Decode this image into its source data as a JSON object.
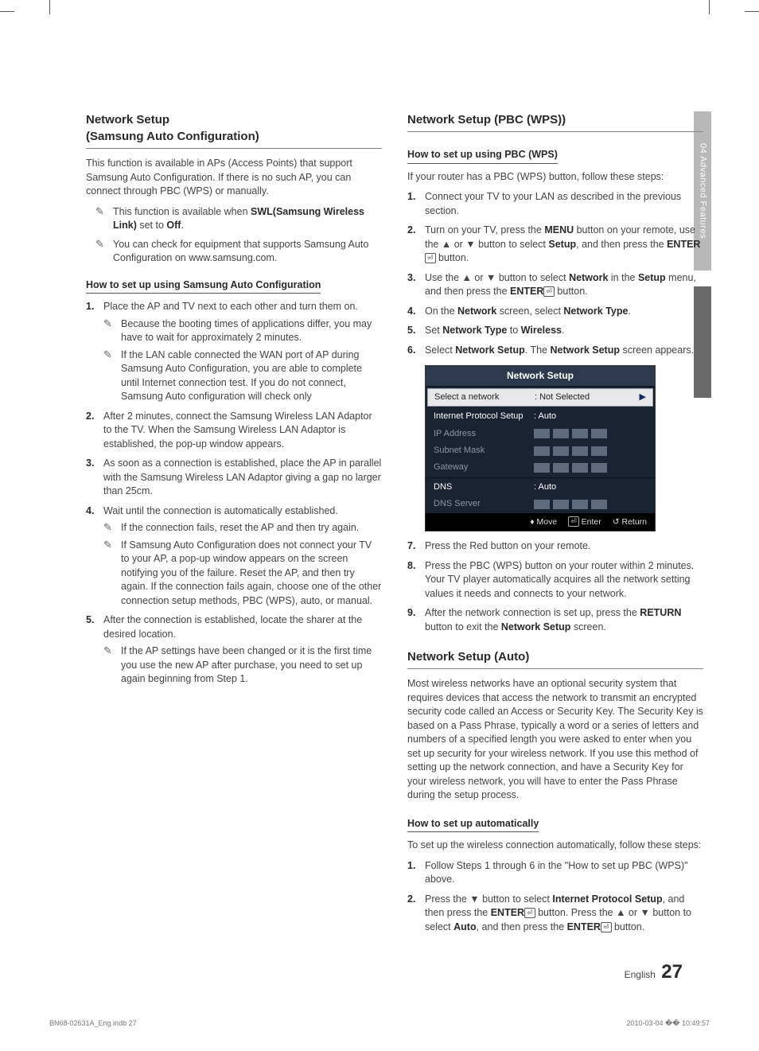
{
  "sideTab": {
    "label": "04  Advanced Features"
  },
  "left": {
    "title": "Network Setup\n(Samsung Auto Configuration)",
    "intro": "This function is available in APs (Access Points) that support Samsung Auto Configuration. If there is no such AP, you can connect through PBC (WPS) or manually.",
    "notes": [
      "This function is available when SWL(Samsung Wireless Link) set to Off.",
      "You can check for equipment that supports Samsung Auto Configuration on www.samsung.com."
    ],
    "subHead": "How to set up using Samsung Auto Configuration",
    "steps": [
      {
        "text": "Place the AP and TV next to each other and turn them on.",
        "subs": [
          "Because the booting times of applications differ, you may have to wait for approximately 2 minutes.",
          "If the LAN cable connected the WAN port of AP during Samsung Auto Configuration, you are able to complete until Internet connection test. If you do not connect, Samsung Auto configuration will check only"
        ]
      },
      {
        "text": "After 2 minutes, connect the Samsung Wireless LAN Adaptor to the TV. When the Samsung Wireless LAN Adaptor is established, the pop-up window appears."
      },
      {
        "text": "As soon as a connection is established, place the AP in parallel with the Samsung Wireless LAN Adaptor giving a gap no larger than 25cm."
      },
      {
        "text": "Wait until the connection is automatically established.",
        "subs": [
          "If the connection fails, reset the AP and then try again.",
          "If Samsung Auto Configuration does not connect your TV to your AP, a pop-up window appears on the screen notifying you of the failure. Reset the AP, and then try again. If the connection fails again, choose one of the other connection setup methods, PBC (WPS), auto, or manual."
        ]
      },
      {
        "text": "After the connection is established, locate the sharer at the desired location.",
        "subs": [
          "If the AP settings have been changed or it is the first time you use the new AP after purchase, you need to set up again beginning from Step 1."
        ]
      }
    ]
  },
  "rightPbc": {
    "title": "Network Setup (PBC (WPS))",
    "subHead": "How to set up using PBC (WPS)",
    "intro": "If your router has a PBC (WPS) button, follow these steps:",
    "steps1": [
      "Connect your TV to your LAN as described in the previous section.",
      "Turn on your TV, press the MENU button on your remote, use the ▲ or ▼ button to select Setup, and then press the ENTER button.",
      "Use the ▲ or ▼ button to select Network in the Setup menu, and then press the ENTER button.",
      "On the Network screen, select Network Type.",
      "Set Network Type to Wireless.",
      "Select Network Setup. The Network Setup screen appears."
    ],
    "steps2": [
      "Press the Red button on your remote.",
      "Press the PBC (WPS) button on your router within 2 minutes. Your TV player automatically acquires all the network setting values it needs and connects to your network.",
      "After the network connection is set up, press the RETURN button to exit the Network Setup screen."
    ]
  },
  "osd": {
    "title": "Network Setup",
    "rows": {
      "selectNetwork": {
        "label": "Select a network",
        "value": ": Not Selected"
      },
      "ips": {
        "label": "Internet Protocol Setup",
        "value": ": Auto"
      },
      "ip": "IP Address",
      "subnet": "Subnet Mask",
      "gateway": "Gateway",
      "dns": {
        "label": "DNS",
        "value": ": Auto"
      },
      "dnsServer": "DNS Server"
    },
    "foot": {
      "move": "Move",
      "enter": "Enter",
      "return": "Return"
    }
  },
  "rightAuto": {
    "title": "Network Setup (Auto)",
    "intro": "Most wireless networks have an optional security system that requires devices that access the network to transmit an encrypted security code called an Access or Security Key. The Security Key is based on a Pass Phrase, typically a word or a series of letters and numbers of a specified length you were asked to enter when you set up security for your wireless network. If you use this method of setting up the network connection, and have a Security Key for your wireless network, you will have to enter the Pass Phrase during the setup process.",
    "subHead": "How to set up automatically",
    "lead": "To set up the wireless connection automatically, follow these steps:",
    "steps": [
      "Follow Steps 1 through 6 in the \"How to set up PBC (WPS)\" above.",
      "Press the ▼ button to select Internet Protocol Setup, and then press the ENTER button. Press the ▲ or ▼ button to select Auto, and then press the ENTER button."
    ]
  },
  "pageFoot": {
    "lang": "English",
    "num": "27"
  },
  "footer": {
    "left": "BN68-02631A_Eng.indb   27",
    "right": "2010-03-04   �� 10:49:57"
  }
}
